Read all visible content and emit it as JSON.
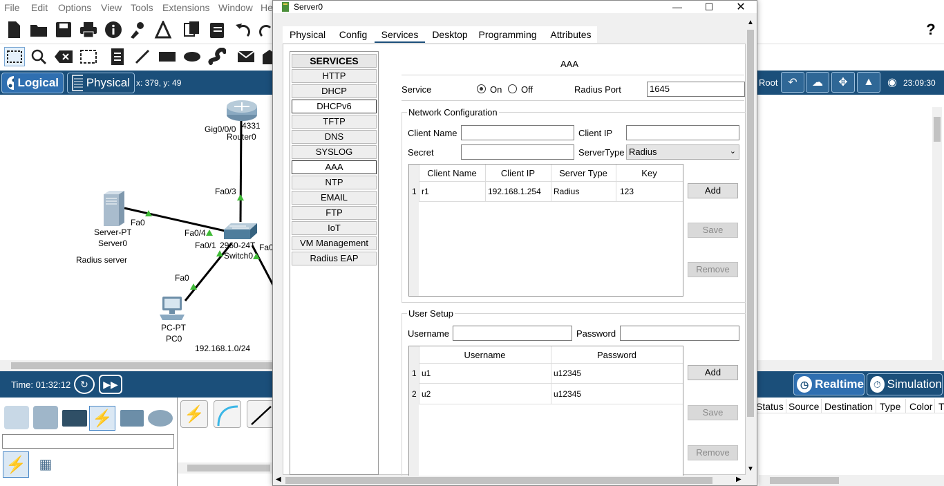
{
  "menu": [
    "File",
    "Edit",
    "Options",
    "View",
    "Tools",
    "Extensions",
    "Window",
    "He"
  ],
  "viewbar": {
    "logical_label": "Logical",
    "physical_label": "Physical",
    "coords": "x: 379, y: 49",
    "root_label": "Root",
    "clock": "23:09:30"
  },
  "topology": {
    "router_model": "4331",
    "router_name": "Router0",
    "router_port": "Gig0/0/0",
    "switch_uplink": "Fa0/3",
    "switch_model": "2960-24T",
    "switch_name": "Switch0",
    "switch_port_server": "Fa0/4",
    "switch_port_pc": "Fa0/1",
    "switch_port_right": "Fa0",
    "server_port": "Fa0",
    "server_model": "Server-PT",
    "server_name": "Server0",
    "server_note": "Radius server",
    "pc_port": "Fa0",
    "pc_model": "PC-PT",
    "pc_name": "PC0",
    "network_note": "192.168.1.0/24"
  },
  "timebar": {
    "time": "Time: 01:32:12",
    "realtime_label": "Realtime",
    "simulation_label": "Simulation"
  },
  "event_list": {
    "columns": [
      "Status",
      "Source",
      "Destination",
      "Type",
      "Color",
      "T"
    ]
  },
  "dialog": {
    "title": "Server0",
    "tabs": [
      "Physical",
      "Config",
      "Services",
      "Desktop",
      "Programming",
      "Attributes"
    ],
    "services": {
      "header": "SERVICES",
      "items": [
        "HTTP",
        "DHCP",
        "DHCPv6",
        "TFTP",
        "DNS",
        "SYSLOG",
        "AAA",
        "NTP",
        "EMAIL",
        "FTP",
        "IoT",
        "VM Management",
        "Radius EAP"
      ]
    },
    "aaa": {
      "heading": "AAA",
      "service_label": "Service",
      "on_label": "On",
      "off_label": "Off",
      "service_state": "On",
      "radius_port_label": "Radius Port",
      "radius_port_value": "1645",
      "network_config_label": "Network Configuration",
      "client_name_label": "Client Name",
      "client_name_value": "",
      "client_ip_label": "Client IP",
      "client_ip_value": "",
      "secret_label": "Secret",
      "secret_value": "",
      "server_type_label": "ServerType",
      "server_type_value": "Radius",
      "network_table": {
        "headers": [
          "Client Name",
          "Client IP",
          "Server Type",
          "Key"
        ],
        "rows": [
          {
            "num": "1",
            "client_name": "r1",
            "client_ip": "192.168.1.254",
            "server_type": "Radius",
            "key": "123"
          }
        ]
      },
      "add_label": "Add",
      "save_label": "Save",
      "remove_label": "Remove",
      "user_setup_label": "User Setup",
      "username_label": "Username",
      "username_value": "",
      "password_label": "Password",
      "password_value": "",
      "user_table": {
        "headers": [
          "Username",
          "Password"
        ],
        "rows": [
          {
            "num": "1",
            "username": "u1",
            "password": "u12345"
          },
          {
            "num": "2",
            "username": "u2",
            "password": "u12345"
          }
        ]
      }
    }
  }
}
